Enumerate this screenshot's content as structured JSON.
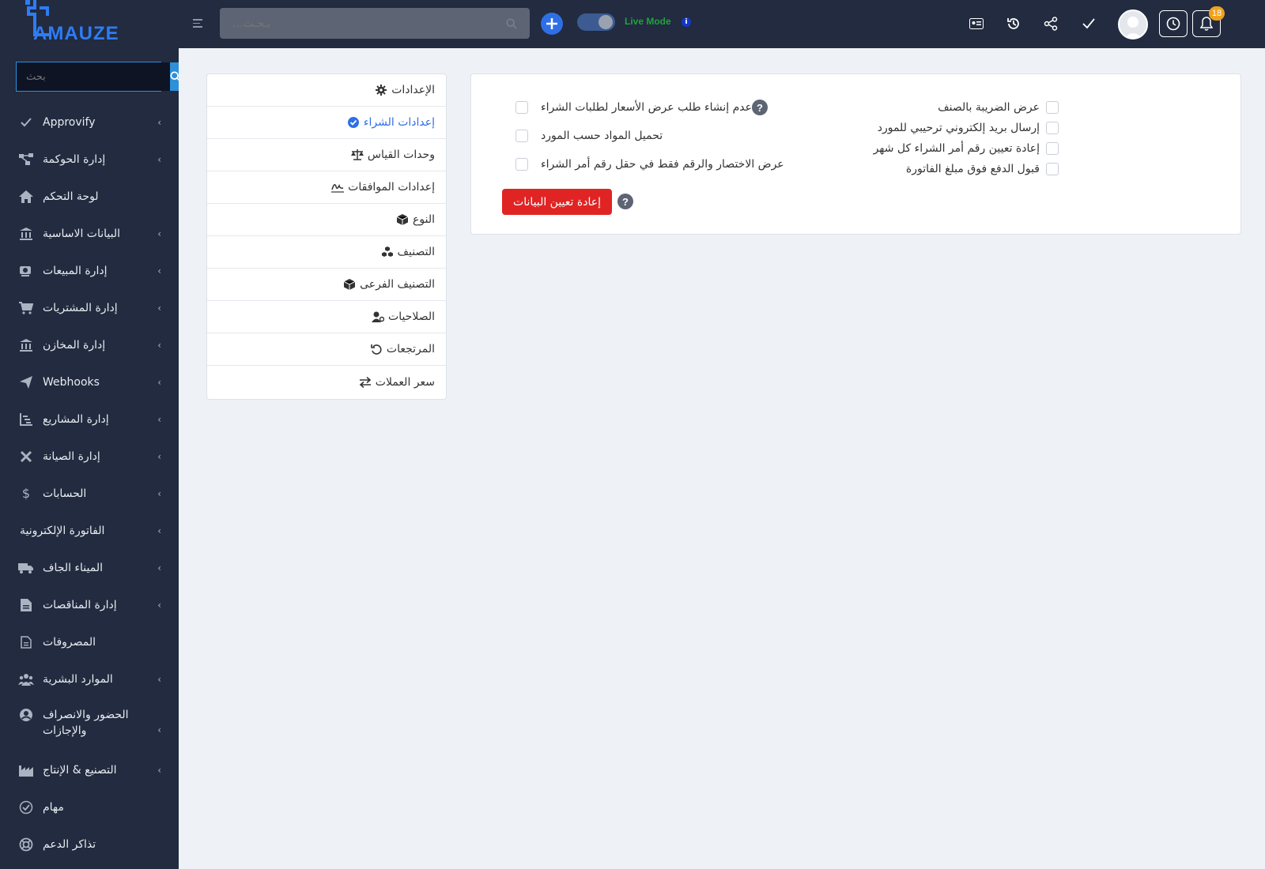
{
  "brand": {
    "name": "AMAUZE",
    "color": "#2e7cf6"
  },
  "sidebar": {
    "search": {
      "placeholder": "بحث"
    },
    "items": [
      {
        "label": "Approvify",
        "icon": "check-icon",
        "has_chevron": true
      },
      {
        "label": "إدارة الحوكمة",
        "icon": "sitemap-icon",
        "has_chevron": true
      },
      {
        "label": "لوحة التحكم",
        "icon": "home-icon",
        "has_chevron": false
      },
      {
        "label": "البيانات الاساسية",
        "icon": "bank-icon",
        "has_chevron": true
      },
      {
        "label": "إدارة المبيعات",
        "icon": "sales-icon",
        "has_chevron": true
      },
      {
        "label": "إدارة المشتريات",
        "icon": "cart-icon",
        "has_chevron": true
      },
      {
        "label": "إدارة المخازن",
        "icon": "warehouse-icon",
        "has_chevron": true
      },
      {
        "label": "Webhooks",
        "icon": "send-icon",
        "has_chevron": true
      },
      {
        "label": "إدارة المشاريع",
        "icon": "project-icon",
        "has_chevron": true
      },
      {
        "label": "إدارة الصيانة",
        "icon": "tools-icon",
        "has_chevron": true
      },
      {
        "label": "الحسابات",
        "icon": "dollar-icon",
        "has_chevron": true
      },
      {
        "label": "الفاتورة الإلكترونية",
        "icon": "",
        "has_chevron": true
      },
      {
        "label": "الميناء الجاف",
        "icon": "truck-icon",
        "has_chevron": true
      },
      {
        "label": "إدارة المناقصات",
        "icon": "tender-icon",
        "has_chevron": true
      },
      {
        "label": "المصروفات",
        "icon": "file-icon",
        "has_chevron": false
      },
      {
        "label": "الموارد البشرية",
        "icon": "users-icon",
        "has_chevron": true
      },
      {
        "label": "الحضور والانصراف والإجازات",
        "icon": "user-circle-icon",
        "has_chevron": true
      },
      {
        "label": "التصنيع & الإنتاج",
        "icon": "factory-icon",
        "has_chevron": true
      },
      {
        "label": "مهام",
        "icon": "check-circle-icon",
        "has_chevron": false
      },
      {
        "label": "تذاكر الدعم",
        "icon": "lifebuoy-icon",
        "has_chevron": false
      }
    ]
  },
  "topbar": {
    "search": {
      "placeholder": "بـحـث..."
    },
    "live_mode_label": "Live Mode",
    "live_mode_on": true,
    "notification_count": "18",
    "icons": [
      "id-card-icon",
      "history-icon",
      "share-icon",
      "checkmark-icon",
      "avatar",
      "clock-icon",
      "bell-icon"
    ]
  },
  "settings_nav": {
    "items": [
      {
        "label": "الإعدادات",
        "icon": "gear-icon",
        "active": false
      },
      {
        "label": "إعدادات الشراء",
        "icon": "check-circle-icon",
        "active": true
      },
      {
        "label": "وحدات القياس",
        "icon": "scale-icon",
        "active": false
      },
      {
        "label": "إعدادات الموافقات",
        "icon": "signature-icon",
        "active": false
      },
      {
        "label": "النوع",
        "icon": "cube-icon",
        "active": false
      },
      {
        "label": "التصنيف",
        "icon": "cubes-icon",
        "active": false
      },
      {
        "label": "التصنيف الفرعى",
        "icon": "cube-icon",
        "active": false
      },
      {
        "label": "الصلاحيات",
        "icon": "user-gear-icon",
        "active": false
      },
      {
        "label": "المرتجعات",
        "icon": "undo-icon",
        "active": false
      },
      {
        "label": "سعر العملات",
        "icon": "exchange-icon",
        "active": false
      }
    ]
  },
  "purchase_settings": {
    "right_column": [
      {
        "label": "عرض الضريبة بالصنف",
        "checked": false
      },
      {
        "label": "إرسال بريد إلكتروني ترحيبي للمورد",
        "checked": false
      },
      {
        "label": "إعادة تعيين رقم أمر الشراء كل شهر",
        "checked": false
      },
      {
        "label": "قبول الدفع فوق مبلغ الفاتورة",
        "checked": false
      }
    ],
    "left_column": [
      {
        "label": "عدم إنشاء طلب عرض الأسعار لطلبات الشراء",
        "checked": false,
        "help": true
      },
      {
        "label": "تحميل المواد حسب المورد",
        "checked": false,
        "help": false
      },
      {
        "label": "عرض الاختصار والرقم فقط في حقل رقم أمر الشراء",
        "checked": false,
        "help": false
      }
    ],
    "reset_button": "إعادة تعيين البيانات",
    "help_glyph": "?"
  }
}
